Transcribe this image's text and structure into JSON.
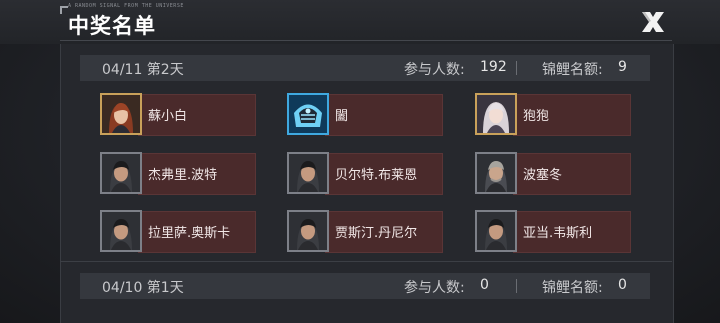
{
  "header": {
    "title": "中奖名单",
    "tagline": "A RANDOM SIGNAL FROM THE UNIVERSE"
  },
  "days": [
    {
      "date": "04/11 第2天",
      "participants_label": "参与人数:",
      "participants": "192",
      "quota_label": "锦鲤名额:",
      "quota": "9",
      "winners": [
        {
          "name": "蘇小白",
          "avatar": "red-hair-woman-avatar"
        },
        {
          "name": "闔",
          "avatar": "blue-mecha-mask-avatar"
        },
        {
          "name": "狍狍",
          "avatar": "silver-hair-girl-avatar"
        },
        {
          "name": "杰弗里.波特",
          "avatar": "dark-hair-man-avatar"
        },
        {
          "name": "贝尔特.布莱恩",
          "avatar": "dark-hair-man-avatar"
        },
        {
          "name": "波塞冬",
          "avatar": "gray-hair-man-avatar"
        },
        {
          "name": "拉里萨.奥斯卡",
          "avatar": "dark-hair-man-avatar"
        },
        {
          "name": "贾斯汀.丹尼尔",
          "avatar": "dark-hair-man-avatar"
        },
        {
          "name": "亚当.韦斯利",
          "avatar": "dark-hair-man-avatar"
        }
      ]
    },
    {
      "date": "04/10 第1天",
      "participants_label": "参与人数:",
      "participants": "0",
      "quota_label": "锦鲤名额:",
      "quota": "0",
      "winners": []
    }
  ],
  "colors": {
    "background": "#1c1e22",
    "panel": "#26282d",
    "header_row": "#35383e",
    "winner_bar": "#4a2a2b",
    "gold_frame": "#c9a15a"
  }
}
